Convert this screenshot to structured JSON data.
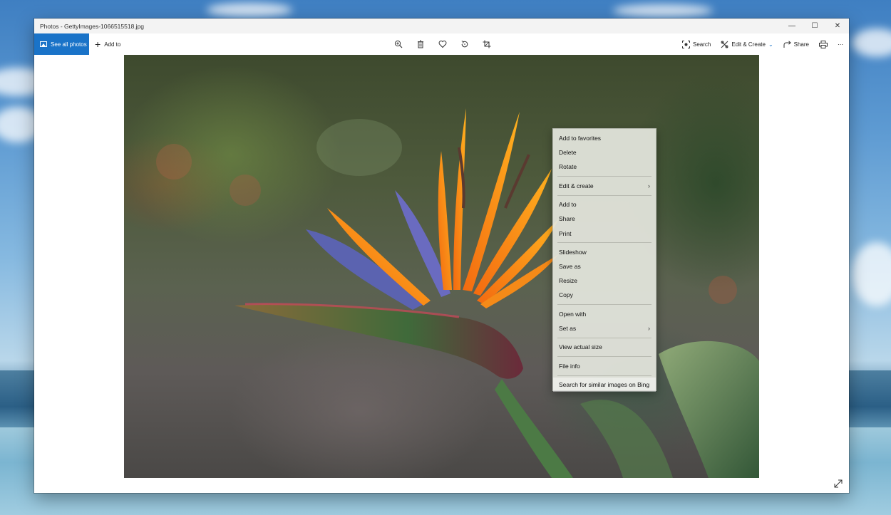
{
  "window": {
    "title": "Photos - GettyImages-1066515518.jpg",
    "controls": {
      "minimize": "—",
      "maximize": "☐",
      "close": "✕"
    }
  },
  "toolbar": {
    "see_all_label": "See all photos",
    "add_to_label": "Add to",
    "search_label": "Search",
    "edit_create_label": "Edit & Create",
    "share_label": "Share",
    "more_label": "⋯",
    "icons": [
      "zoom-in-icon",
      "delete-icon",
      "heart-icon",
      "rotate-icon",
      "crop-icon",
      "print-icon"
    ]
  },
  "colors": {
    "accent": "#1a73c8"
  },
  "context_menu": {
    "groups": [
      [
        "Add to favorites",
        "Delete",
        "Rotate"
      ],
      [
        "Edit & create"
      ],
      [
        "Add to",
        "Share",
        "Print"
      ],
      [
        "Slideshow",
        "Save as",
        "Resize",
        "Copy"
      ],
      [
        "Open with",
        "Set as"
      ],
      [
        "View actual size"
      ],
      [
        "File info"
      ],
      [
        "Search for similar images on Bing"
      ]
    ],
    "items": {
      "add_to_favorites": "Add to favorites",
      "delete": "Delete",
      "rotate": "Rotate",
      "edit_create": "Edit & create",
      "add_to": "Add to",
      "share": "Share",
      "print": "Print",
      "slideshow": "Slideshow",
      "save_as": "Save as",
      "resize": "Resize",
      "copy": "Copy",
      "open_with": "Open with",
      "set_as": "Set as",
      "view_actual_size": "View actual size",
      "file_info": "File info",
      "search_bing": "Search for similar images on Bing"
    },
    "submenu_arrow": "›",
    "highlighted": "Search for similar images on Bing"
  }
}
